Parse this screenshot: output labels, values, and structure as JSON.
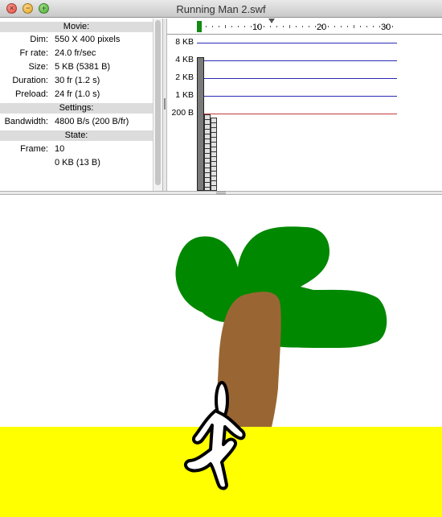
{
  "window": {
    "title": "Running Man 2.swf",
    "close_glyph": "×",
    "minimize_glyph": "−",
    "zoom_glyph": "+"
  },
  "info": {
    "movie_header": "Movie:",
    "dim_label": "Dim:",
    "dim_value": "550 X 400 pixels",
    "frrate_label": "Fr rate:",
    "frrate_value": "24.0 fr/sec",
    "size_label": "Size:",
    "size_value": "5 KB (5381 B)",
    "duration_label": "Duration:",
    "duration_value": "30 fr (1.2 s)",
    "preload_label": "Preload:",
    "preload_value": "24 fr (1.0 s)",
    "settings_header": "Settings:",
    "bandwidth_label": "Bandwidth:",
    "bandwidth_value": "4800 B/s (200 B/fr)",
    "state_header": "State:",
    "frame_label": "Frame:",
    "frame_value": "10",
    "frame_bytes": "0 KB (13 B)"
  },
  "timeline": {
    "ticks": [
      "10",
      "20",
      "30"
    ],
    "current_frame": 10
  },
  "graph": {
    "levels": [
      "8 KB",
      "4 KB",
      "2 KB",
      "1 KB",
      "200 B"
    ],
    "stream_limit_label": "200 B"
  },
  "colors": {
    "tree_leaves": "#008800",
    "tree_trunk": "#996633",
    "ground": "#ffff00",
    "playhead": "#138a13",
    "bandwidth_line": "#c53a3a",
    "grid_line": "#2a2ab8"
  },
  "icons": {
    "close": "close-icon",
    "minimize": "minimize-icon",
    "zoom": "zoom-icon"
  }
}
